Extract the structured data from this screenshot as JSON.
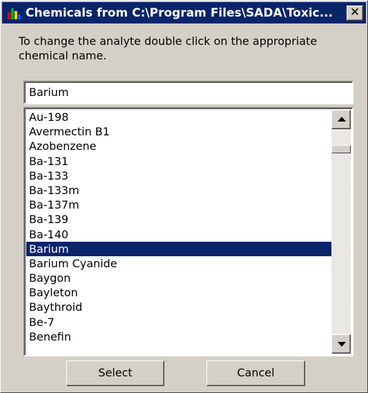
{
  "window": {
    "title": "Chemicals from C:\\Program Files\\SADA\\Toxic..."
  },
  "instruction": "To change the analyte double click on the appropriate chemical name.",
  "search": {
    "value": "Barium"
  },
  "list": {
    "items": [
      "Au-198",
      "Avermectin B1",
      "Azobenzene",
      "Ba-131",
      "Ba-133",
      "Ba-133m",
      "Ba-137m",
      "Ba-139",
      "Ba-140",
      "Barium",
      "Barium Cyanide",
      "Baygon",
      "Bayleton",
      "Baythroid",
      "Be-7",
      "Benefin"
    ],
    "selected": "Barium"
  },
  "buttons": {
    "select": "Select",
    "cancel": "Cancel"
  },
  "colors": {
    "title_bar": "#0a246a",
    "selection": "#0a246a",
    "face": "#d4d0c8"
  }
}
